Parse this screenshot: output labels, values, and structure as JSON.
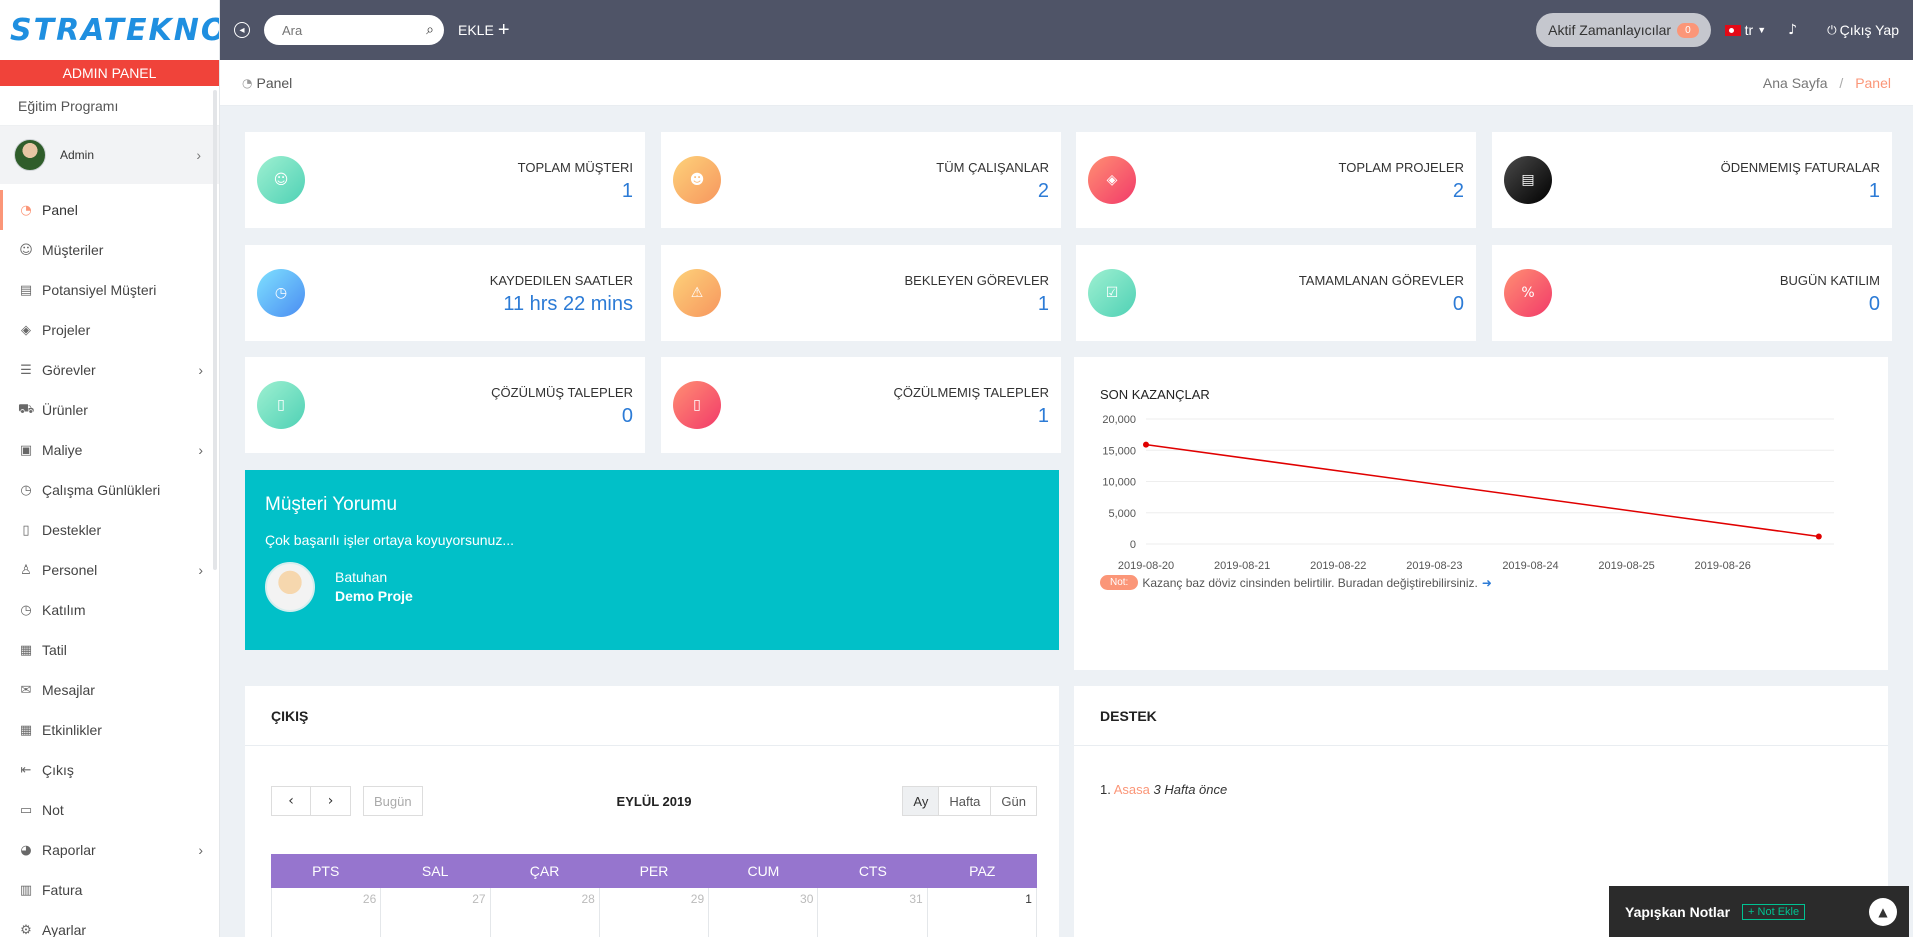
{
  "brand": {
    "logo": "STRATEKNO"
  },
  "sidebar": {
    "admin_label": "ADMIN PANEL",
    "program_label": "Eğitim Programı",
    "user_name": "Admin",
    "items": [
      {
        "label": "Panel",
        "icon": "dashboard-icon",
        "active": true
      },
      {
        "label": "Müşteriler",
        "icon": "users-icon"
      },
      {
        "label": "Potansiyel Müşteri",
        "icon": "document-icon"
      },
      {
        "label": "Projeler",
        "icon": "layers-icon"
      },
      {
        "label": "Görevler",
        "icon": "tasks-icon",
        "has_sub": true
      },
      {
        "label": "Ürünler",
        "icon": "cart-icon"
      },
      {
        "label": "Maliye",
        "icon": "money-icon",
        "has_sub": true
      },
      {
        "label": "Çalışma Günlükleri",
        "icon": "clock-icon"
      },
      {
        "label": "Destekler",
        "icon": "ticket-icon"
      },
      {
        "label": "Personel",
        "icon": "person-icon",
        "has_sub": true
      },
      {
        "label": "Katılım",
        "icon": "clock-icon"
      },
      {
        "label": "Tatil",
        "icon": "calendar-icon"
      },
      {
        "label": "Mesajlar",
        "icon": "envelope-icon"
      },
      {
        "label": "Etkinlikler",
        "icon": "calendar-grid-icon"
      },
      {
        "label": "Çıkış",
        "icon": "logout-icon"
      },
      {
        "label": "Not",
        "icon": "laptop-icon"
      },
      {
        "label": "Raporlar",
        "icon": "pie-chart-icon",
        "has_sub": true
      },
      {
        "label": "Fatura",
        "icon": "book-icon"
      },
      {
        "label": "Ayarlar",
        "icon": "gear-icon"
      }
    ]
  },
  "topbar": {
    "search_placeholder": "Ara",
    "add_label": "EKLE",
    "timers_label": "Aktif Zamanlayıcılar",
    "timers_count": "0",
    "lang": "tr",
    "logout_label": "Çıkış Yap"
  },
  "page": {
    "title": "Panel",
    "breadcrumb_home": "Ana Sayfa",
    "breadcrumb_current": "Panel"
  },
  "stats": [
    {
      "label": "TOPLAM MÜŞTERI",
      "value": "1",
      "icon": "user-icon",
      "color": "teal"
    },
    {
      "label": "TÜM ÇALIŞANLAR",
      "value": "2",
      "icon": "employees-icon",
      "color": "orange"
    },
    {
      "label": "TOPLAM PROJELER",
      "value": "2",
      "icon": "layers-icon",
      "color": "red"
    },
    {
      "label": "ÖDENMEMIŞ FATURALAR",
      "value": "1",
      "icon": "invoice-icon",
      "color": "black"
    },
    {
      "label": "KAYDEDILEN SAATLER",
      "value": "11 hrs 22 mins",
      "icon": "clock-icon",
      "color": "blue"
    },
    {
      "label": "BEKLEYEN GÖREVLER",
      "value": "1",
      "icon": "warning-icon",
      "color": "orange"
    },
    {
      "label": "TAMAMLANAN GÖREVLER",
      "value": "0",
      "icon": "check-icon",
      "color": "teal"
    },
    {
      "label": "BUGÜN KATILIM",
      "value": "0",
      "icon": "percent-icon",
      "color": "red"
    },
    {
      "label": "ÇÖZÜLMÜŞ TALEPLER",
      "value": "0",
      "icon": "ticket-icon",
      "color": "teal"
    },
    {
      "label": "ÇÖZÜLMEMIŞ TALEPLER",
      "value": "1",
      "icon": "ticket-icon",
      "color": "red"
    }
  ],
  "testimonial": {
    "title": "Müşteri Yorumu",
    "quote": "Çok başarılı işler ortaya koyuyorsunuz...",
    "name": "Batuhan",
    "project": "Demo Proje"
  },
  "earnings": {
    "title": "SON KAZANÇLAR",
    "note_tag": "Not:",
    "note_text": "Kazanç baz döviz cinsinden belirtilir. Buradan değiştirebilirsiniz."
  },
  "chart_data": {
    "type": "line",
    "title": "SON KAZANÇLAR",
    "x": [
      "2019-08-20",
      "2019-08-21",
      "2019-08-22",
      "2019-08-23",
      "2019-08-24",
      "2019-08-25",
      "2019-08-26"
    ],
    "points": [
      {
        "x": "2019-08-20",
        "y": 15900
      },
      {
        "x": "2019-08-27",
        "y": 1200
      }
    ],
    "y_ticks": [
      "0",
      "5,000",
      "10,000",
      "15,000",
      "20,000"
    ],
    "ylim": [
      0,
      20000
    ],
    "line_color": "#e00000",
    "grid": true
  },
  "exits": {
    "title": "ÇIKIŞ",
    "month": "EYLÜL 2019",
    "today_label": "Bugün",
    "views": [
      "Ay",
      "Hafta",
      "Gün"
    ],
    "weekdays": [
      "PTS",
      "SAL",
      "ÇAR",
      "PER",
      "CUM",
      "CTS",
      "PAZ"
    ],
    "first_week": [
      "26",
      "27",
      "28",
      "29",
      "30",
      "31",
      "1"
    ]
  },
  "support": {
    "title": "DESTEK",
    "items": [
      {
        "index": "1.",
        "link": "Asasa",
        "time": "3 Hafta önce"
      }
    ]
  },
  "sticky": {
    "title": "Yapışkan Notlar",
    "add_label": "+ Not Ekle"
  }
}
